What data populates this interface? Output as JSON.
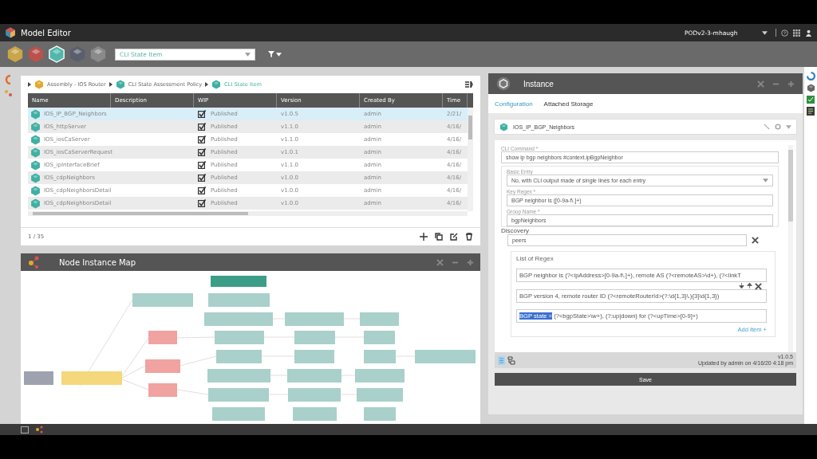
{
  "window": {
    "title": "Model Editor",
    "profile": "PODv2-3-mhaugh"
  },
  "toolbar": {
    "hexes": [
      {
        "color": "#c9a64a",
        "selected": false
      },
      {
        "color": "#b8524d",
        "selected": false
      },
      {
        "color": "#4fb8ab",
        "selected": true
      },
      {
        "color": "#5a5f6e",
        "selected": false
      },
      {
        "color": "#8a8a8a",
        "selected": false
      }
    ],
    "search": {
      "value": "CLI State Item"
    }
  },
  "breadcrumb": [
    {
      "label": "Assembly - IOS Router",
      "color": "#e2a92a"
    },
    {
      "label": "CLI State Assessment Policy",
      "color": "#3fb0a2"
    },
    {
      "label": "CLI State Item",
      "color": "#3fb0a2"
    }
  ],
  "table": {
    "columns": [
      "Name",
      "Description",
      "WIP",
      "Version",
      "Created By",
      "Time"
    ],
    "rows": [
      {
        "name": "IOS_IP_BGP_Neighbors",
        "wip": true,
        "status": "Published",
        "version": "v1.0.5",
        "created_by": "admin",
        "time": "2/21/",
        "selected": true
      },
      {
        "name": "IOS_httpServer",
        "wip": true,
        "status": "Published",
        "version": "v1.1.0",
        "created_by": "admin",
        "time": "4/16/",
        "selected": false
      },
      {
        "name": "IOS_iosCaServer",
        "wip": true,
        "status": "Published",
        "version": "v1.1.0",
        "created_by": "admin",
        "time": "4/16/",
        "selected": false
      },
      {
        "name": "IOS_iosCaServerRequest",
        "wip": true,
        "status": "Published",
        "version": "v1.0.1",
        "created_by": "admin",
        "time": "4/16/",
        "selected": false
      },
      {
        "name": "IOS_ipInterfaceBrief",
        "wip": true,
        "status": "Published",
        "version": "v1.1.0",
        "created_by": "admin",
        "time": "4/16/",
        "selected": false
      },
      {
        "name": "IOS_cdpNeighbors",
        "wip": true,
        "status": "Published",
        "version": "v1.0.0",
        "created_by": "admin",
        "time": "4/16/",
        "selected": false
      },
      {
        "name": "IOS_cdpNeighborsDetail",
        "wip": true,
        "status": "Published",
        "version": "v1.0.0",
        "created_by": "admin",
        "time": "4/16/",
        "selected": false
      },
      {
        "name": "IOS_cdpNeighborsDetail",
        "wip": true,
        "status": "Published",
        "version": "v1.0.0",
        "created_by": "admin",
        "time": "4/16/",
        "selected": false
      }
    ],
    "pager": "1 / 35"
  },
  "node_map": {
    "title": "Node Instance Map"
  },
  "instance": {
    "title": "Instance",
    "tabs": [
      {
        "label": "Configuration",
        "selected": true
      },
      {
        "label": "Attached Storage",
        "selected": false
      }
    ],
    "item": "IOS_IP_BGP_Neighbors",
    "cli_command": {
      "label": "CLI Command *",
      "value": "show ip bgp neighbors #context.ipBgpNeighbor"
    },
    "basic_entry": {
      "label": "Basic Entry",
      "value": "No, with CLI output made of single lines for each entry"
    },
    "key_regex": {
      "label": "Key Regex *",
      "value": "BGP neighbor is ([0-9a-f\\.]+)"
    },
    "group_name": {
      "label": "Group Name *",
      "value": "bgpNeighbors"
    },
    "discovery": {
      "label": "Discovery",
      "value": "peers",
      "list_label": "List of Regex",
      "regexes": [
        {
          "text": "BGP neighbor is (?<ipAddress>[0-9a-f\\.]+),  remote AS (?<remoteAS>\\d+), (?<linkT"
        },
        {
          "text": "BGP version 4, remote router ID (?<remoteRouterId>(?:\\d{1,3}\\.){3}\\d{1,3})"
        },
        {
          "selection": "BGP state =",
          "text": " (?<bgpState>\\w+), (?:up|down) for (?<upTime>[0-9]+)"
        }
      ],
      "add_label": "Add Item +"
    },
    "version": "v1.0.5",
    "updated": "Updated by admin on 4/16/20 4:18 pm",
    "save": "Save"
  }
}
